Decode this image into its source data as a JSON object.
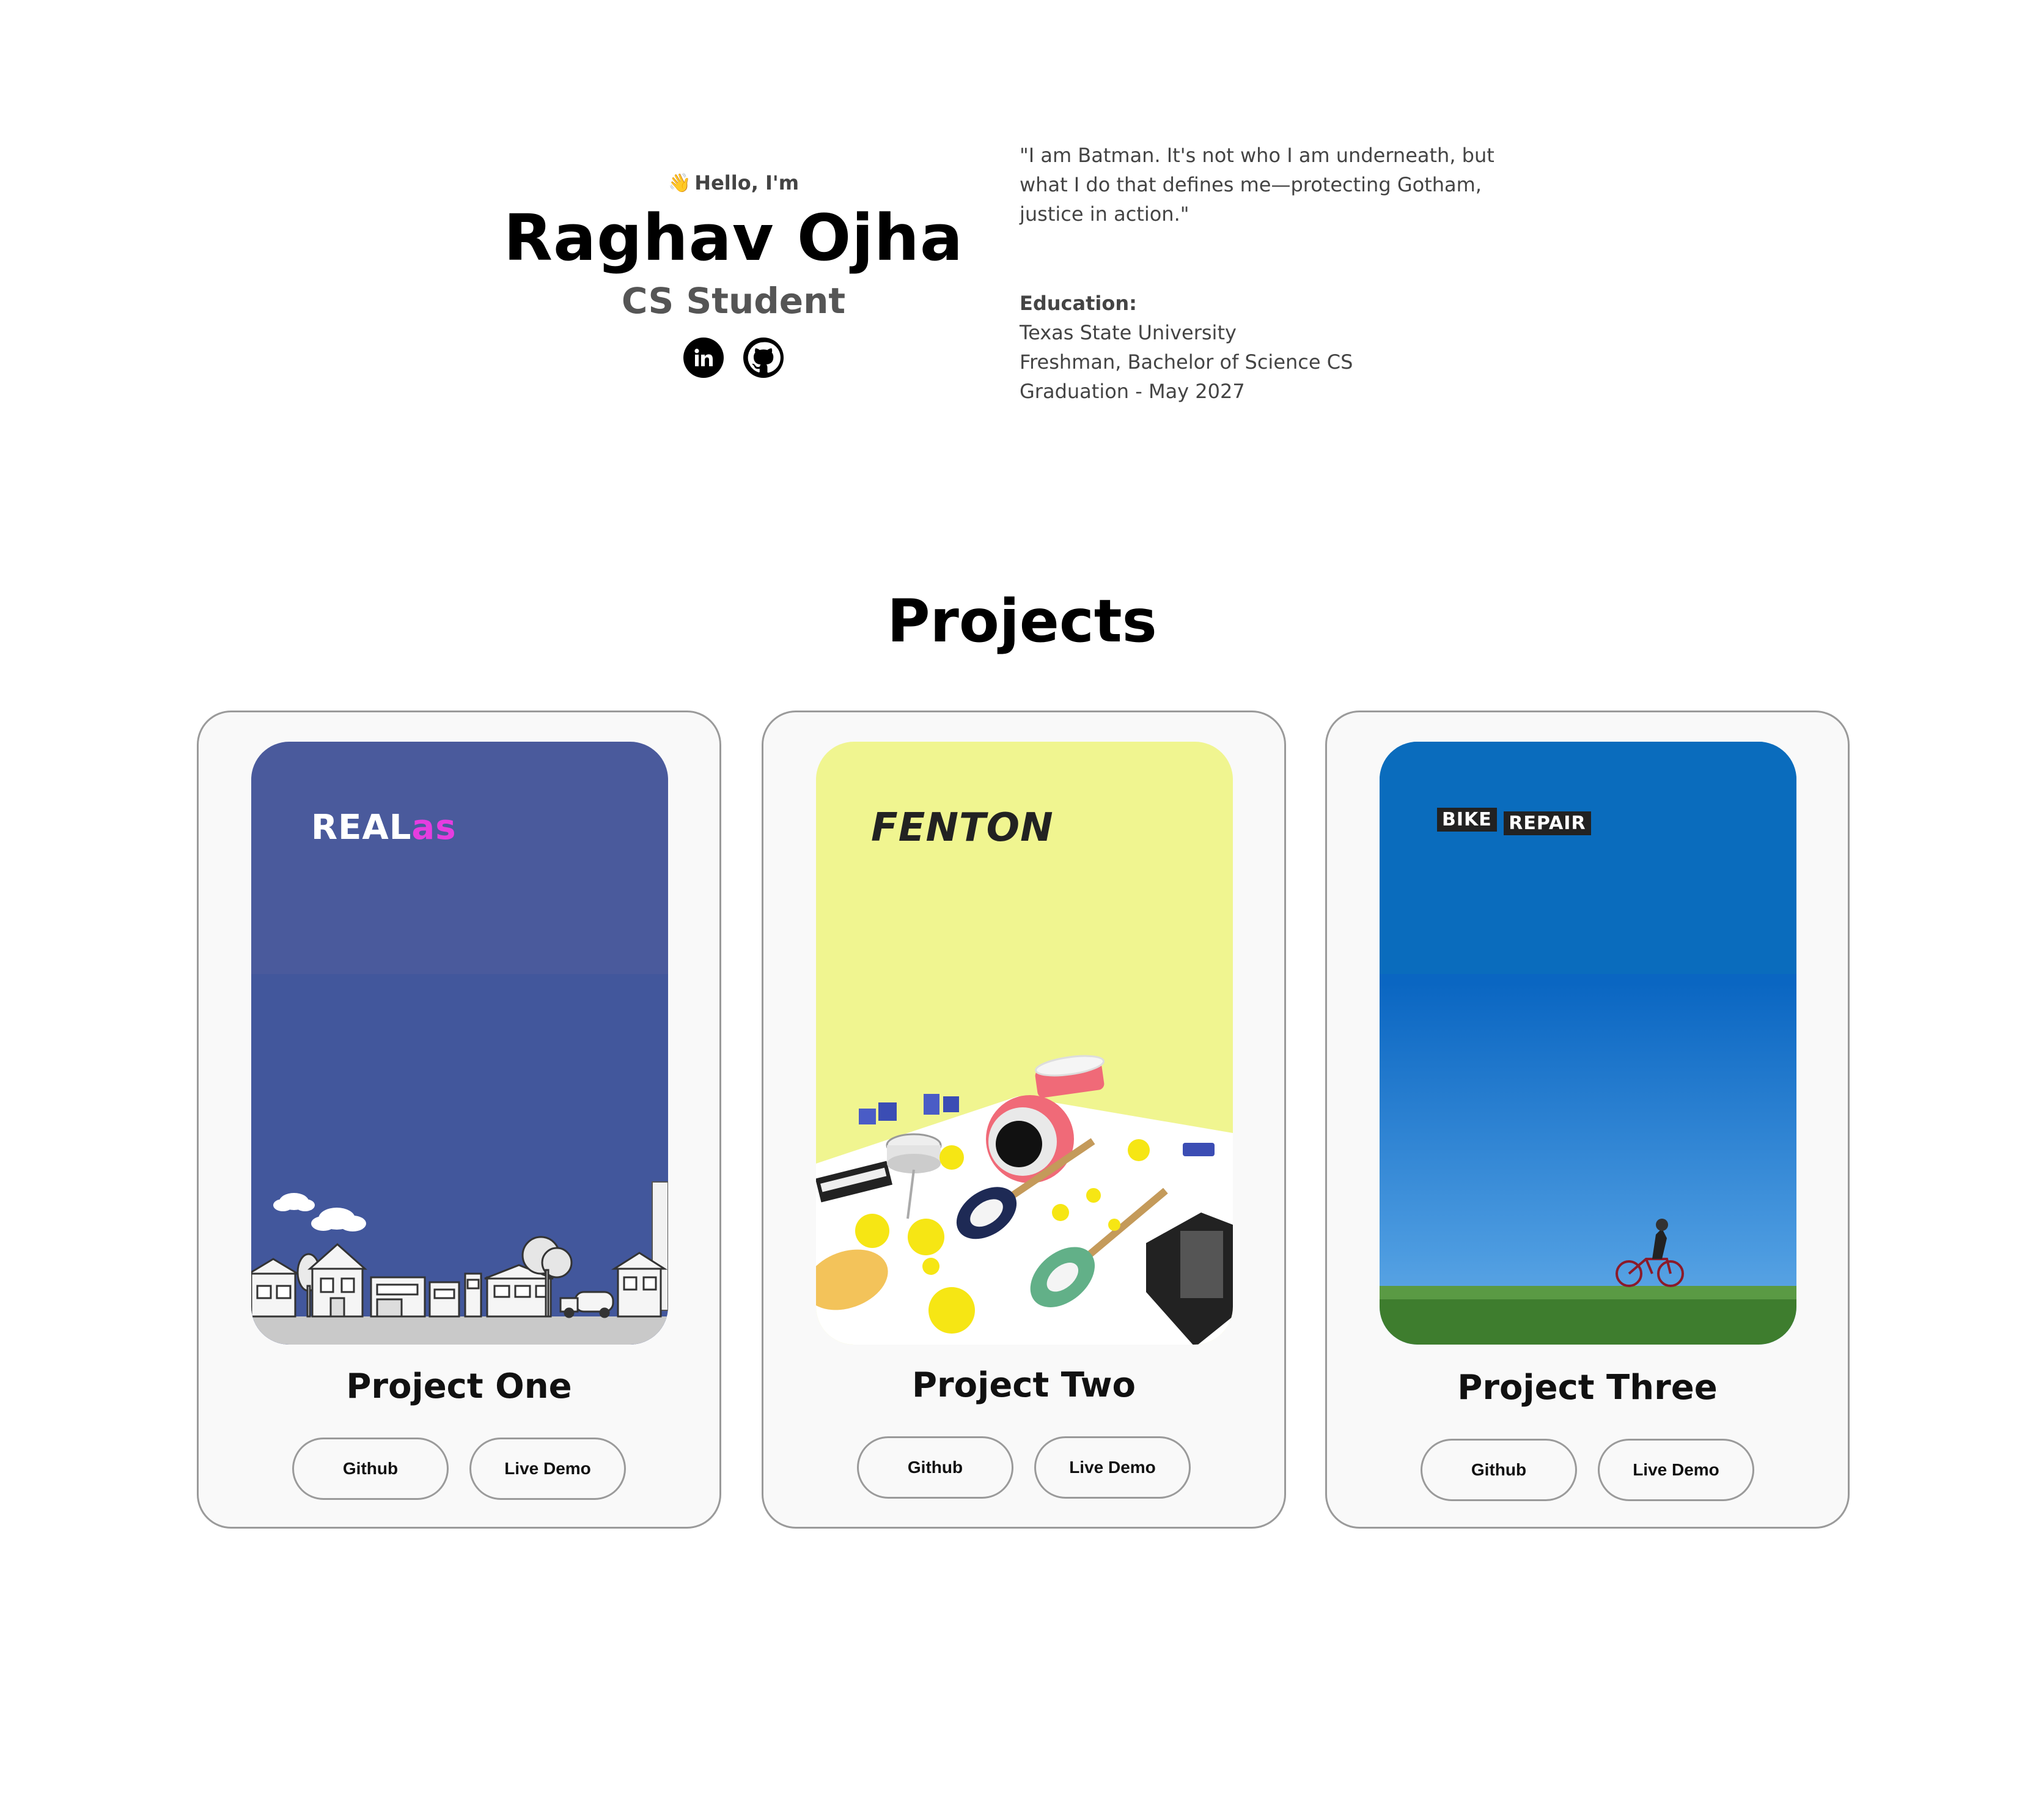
{
  "hero": {
    "greeting": "Hello, I'm",
    "wave_icon": "👋",
    "name": "Raghav Ojha",
    "role": "CS Student",
    "socials": [
      "linkedin-icon",
      "github-icon"
    ]
  },
  "about": {
    "quote": "\"I am Batman. It's not who I am underneath, but what I do that defines me—protecting Gotham, justice in action.\"",
    "education_heading": "Education:",
    "education_lines": [
      "Texas State University",
      "Freshman, Bachelor of Science CS",
      "Graduation - May 2027"
    ]
  },
  "projects": {
    "title": "Projects",
    "items": [
      {
        "title": "Project One",
        "logo_text_a": "REAL",
        "logo_text_b": "as",
        "github_label": "Github",
        "demo_label": "Live Demo",
        "bg_color": "#4a5a9c"
      },
      {
        "title": "Project Two",
        "logo_text": "FENTON",
        "github_label": "Github",
        "demo_label": "Live Demo",
        "bg_color": "#f0f590"
      },
      {
        "title": "Project Three",
        "logo_text_a": "BIKE",
        "logo_text_b": "REPAIR",
        "github_label": "Github",
        "demo_label": "Live Demo",
        "bg_color": "#0a6cbd"
      }
    ]
  },
  "colors": {
    "text": "#000000",
    "muted": "#444444",
    "card_bg": "#f9f9f9",
    "border": "#9a9a9a",
    "accent_pink": "#e63de0"
  }
}
